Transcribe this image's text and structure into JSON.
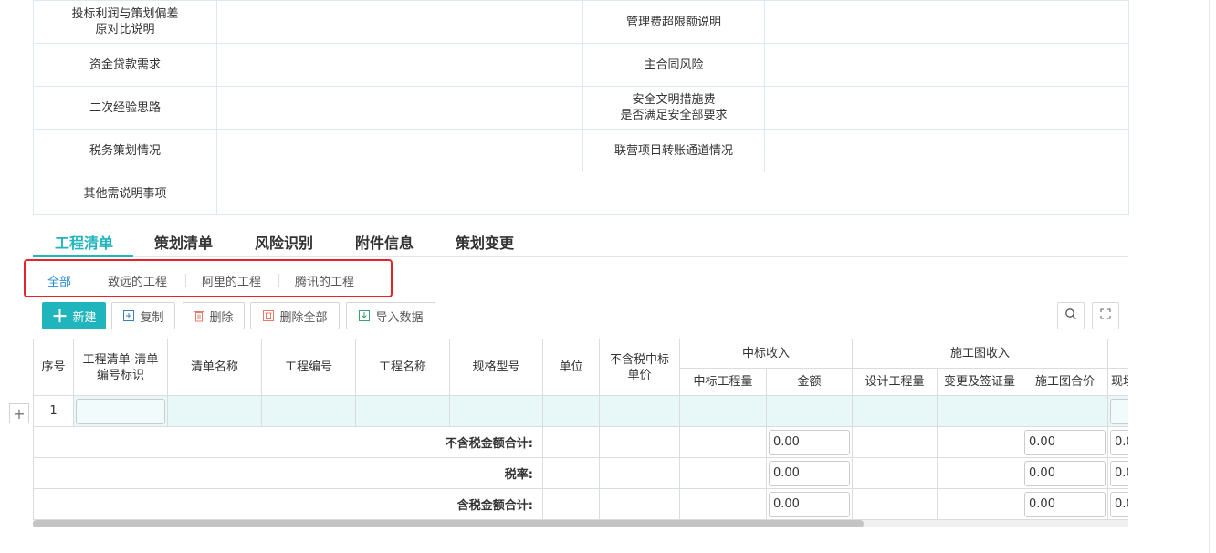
{
  "info": {
    "rows": [
      {
        "l1": "投标利润与策划偏差\n原对比说明",
        "l2": "管理费超限额说明"
      },
      {
        "l1": "资金贷款需求",
        "l2": "主合同风险"
      },
      {
        "l1": "二次经验思路",
        "l2": "安全文明措施费\n是否满足安全部要求"
      },
      {
        "l1": "税务策划情况",
        "l2": "联营项目转账通道情况"
      },
      {
        "l1": "其他需说明事项"
      }
    ]
  },
  "tabs": [
    "工程清单",
    "策划清单",
    "风险识别",
    "附件信息",
    "策划变更"
  ],
  "filters": [
    "全部",
    "致远的工程",
    "阿里的工程",
    "腾讯的工程"
  ],
  "toolbar": {
    "new_label": "新建",
    "copy_label": "复制",
    "delete_label": "删除",
    "delete_all_label": "删除全部",
    "import_label": "导入数据"
  },
  "grid": {
    "headers": {
      "seq": "序号",
      "code": "工程清单-清单\n编号标识",
      "name": "清单名称",
      "proj_no": "工程编号",
      "proj_name": "工程名称",
      "spec": "规格型号",
      "unit": "单位",
      "price": "不含税中标\n单价",
      "bid_income": "中标收入",
      "bid_qty": "中标工程量",
      "amount": "金额",
      "design_income": "施工图收入",
      "design_qty": "设计工程量",
      "change_qty": "变更及签证量",
      "design_price": "施工图合价",
      "cut": "现场"
    },
    "row_seq": "1",
    "sums": [
      {
        "label": "不含税金额合计:",
        "v1": "0.00",
        "v2": "0.00",
        "v3": "0.0"
      },
      {
        "label": "税率:",
        "v1": "0.00",
        "v2": "0.00",
        "v3": "0.0"
      },
      {
        "label": "含税金额合计:",
        "v1": "0.00",
        "v2": "0.00",
        "v3": "0.0"
      }
    ]
  },
  "colors": {
    "accent": "#20b5bd",
    "highlight_border": "#e8222a",
    "link": "#2a8bd6"
  }
}
